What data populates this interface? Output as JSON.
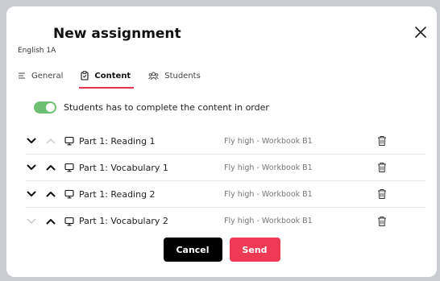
{
  "header": {
    "title": "New assignment",
    "subtitle": "English 1A"
  },
  "tabs": [
    {
      "label": "General",
      "icon": "lines-icon",
      "active": false
    },
    {
      "label": "Content",
      "icon": "clipboard-icon",
      "active": true
    },
    {
      "label": "Students",
      "icon": "users-icon",
      "active": false
    }
  ],
  "toggle": {
    "label": "Students has to complete the content in order",
    "on": true,
    "color": "#6fbf73"
  },
  "content_items": [
    {
      "name": "Part 1: Reading 1",
      "book": "Fly high - Workbook B1",
      "down_enabled": true,
      "up_enabled": false
    },
    {
      "name": "Part 1: Vocabulary 1",
      "book": "Fly high - Workbook B1",
      "down_enabled": true,
      "up_enabled": true
    },
    {
      "name": "Part 1: Reading 2",
      "book": "Fly high - Workbook B1",
      "down_enabled": true,
      "up_enabled": true
    },
    {
      "name": "Part 1: Vocabulary 2",
      "book": "Fly high - Workbook B1",
      "down_enabled": false,
      "up_enabled": true
    }
  ],
  "buttons": {
    "cancel_label": "Cancel",
    "send_label": "Send"
  },
  "colors": {
    "accent": "#e5334d",
    "send": "#ee3a55",
    "cancel": "#000000"
  }
}
